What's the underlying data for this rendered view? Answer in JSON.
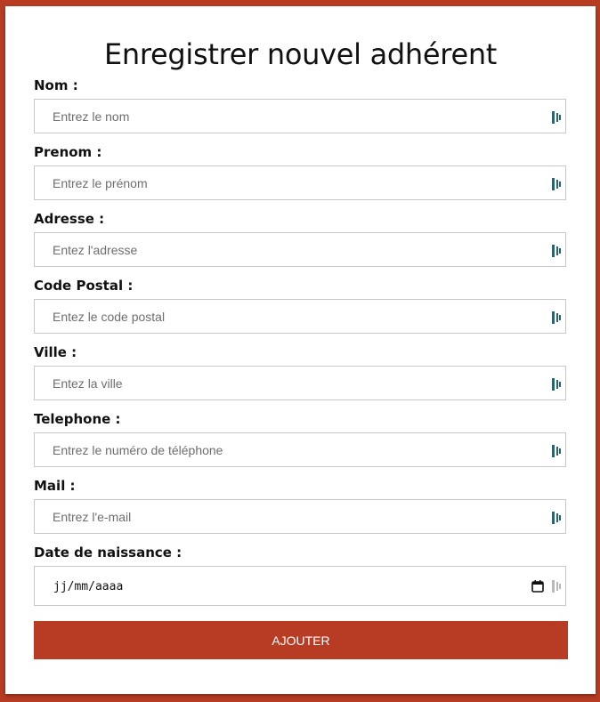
{
  "form": {
    "title": "Enregistrer nouvel adhérent",
    "fields": [
      {
        "label": "Nom :",
        "placeholder": "Entrez le nom"
      },
      {
        "label": "Prenom :",
        "placeholder": "Entrez le prénom"
      },
      {
        "label": "Adresse :",
        "placeholder": "Entez l'adresse"
      },
      {
        "label": "Code Postal :",
        "placeholder": "Entez le code postal"
      },
      {
        "label": "Ville :",
        "placeholder": "Entez la ville"
      },
      {
        "label": "Telephone :",
        "placeholder": "Entrez le numéro de téléphone"
      },
      {
        "label": "Mail :",
        "placeholder": "Entrez l'e-mail"
      }
    ],
    "birthdate": {
      "label": "Date de naissance :",
      "value_format": "jj/mm/aaaa"
    },
    "submit_label": "AJOUTER"
  },
  "colors": {
    "accent": "#b83c23",
    "field_icon": "#2a6470"
  },
  "icons": {
    "field_icon": "password-manager-icon",
    "date_icon": "calendar-icon"
  }
}
